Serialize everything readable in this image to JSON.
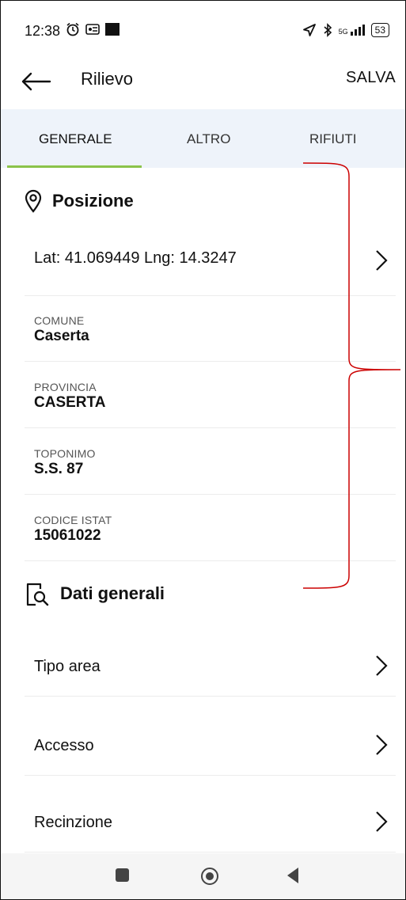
{
  "status_bar": {
    "time": "12:38",
    "signal": "5G",
    "battery": "53"
  },
  "app_bar": {
    "title": "Rilievo",
    "save_label": "SALVA"
  },
  "tabs": [
    {
      "label": "GENERALE",
      "active": true
    },
    {
      "label": "ALTRO",
      "active": false
    },
    {
      "label": "RIFIUTI",
      "active": false
    }
  ],
  "posizione": {
    "title": "Posizione",
    "coordinates": "Lat: 41.069449 Lng: 14.3247",
    "fields": [
      {
        "label": "COMUNE",
        "value": "Caserta"
      },
      {
        "label": "PROVINCIA",
        "value": "CASERTA"
      },
      {
        "label": "TOPONIMO",
        "value": "S.S. 87"
      },
      {
        "label": "CODICE ISTAT",
        "value": "15061022"
      }
    ]
  },
  "dati_generali": {
    "title": "Dati generali",
    "items": [
      {
        "label": "Tipo area"
      },
      {
        "label": "Accesso"
      },
      {
        "label": "Recinzione"
      }
    ]
  },
  "colors": {
    "tab_bg": "#eef3fa",
    "tab_indicator": "#8bc34a",
    "annotation": "#cc0000"
  }
}
